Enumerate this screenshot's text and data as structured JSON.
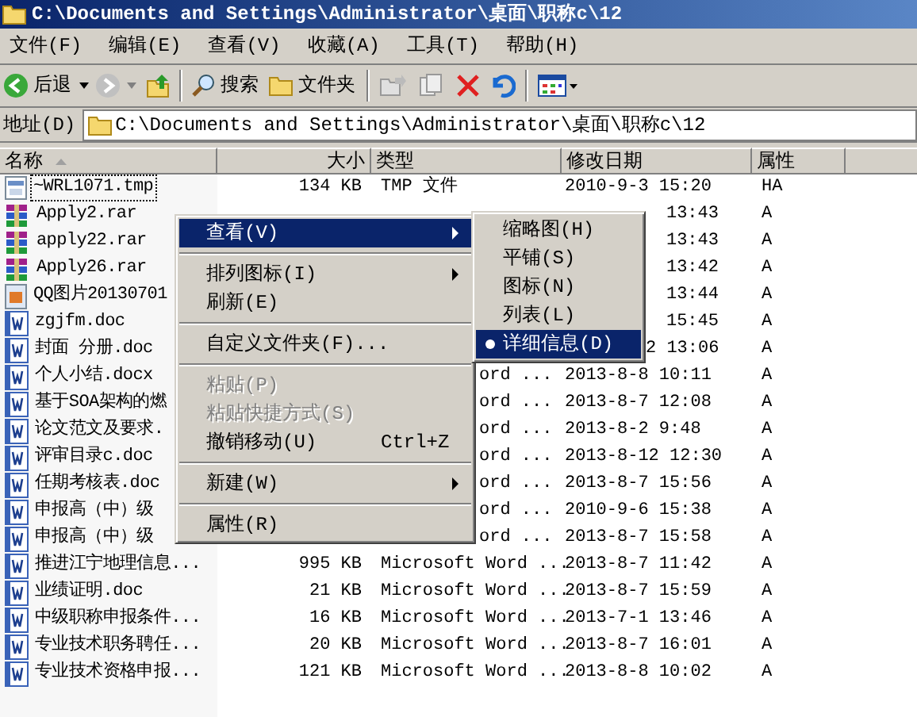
{
  "window": {
    "title": "C:\\Documents and Settings\\Administrator\\桌面\\职称c\\12"
  },
  "menu_bar": [
    "文件(F)",
    "编辑(E)",
    "查看(V)",
    "收藏(A)",
    "工具(T)",
    "帮助(H)"
  ],
  "toolbar": {
    "back": "后退",
    "search": "搜索",
    "folders": "文件夹"
  },
  "address": {
    "label": "地址(D)",
    "value": "C:\\Documents and Settings\\Administrator\\桌面\\职称c\\12"
  },
  "columns": [
    "名称",
    "大小",
    "类型",
    "修改日期",
    "属性"
  ],
  "rows": [
    {
      "kind": "tmp",
      "name": "~WRL1071.tmp",
      "size": "134 KB",
      "type": "TMP 文件",
      "date": "2010-9-3 15:20",
      "attr": "HA",
      "selected": true
    },
    {
      "kind": "rar",
      "name": "Apply2.rar",
      "date": "13:43",
      "attr": "A",
      "selected": false
    },
    {
      "kind": "rar",
      "name": "apply22.rar",
      "date": "13:43",
      "attr": "A",
      "selected": false
    },
    {
      "kind": "rar",
      "name": "Apply26.rar",
      "date": "13:42",
      "attr": "A",
      "selected": false
    },
    {
      "kind": "image",
      "name": "QQ图片20130701",
      "date": "13:44",
      "attr": "A",
      "selected": false
    },
    {
      "kind": "word",
      "name": "zgjfm.doc",
      "date": "15:45",
      "attr": "A",
      "selected": false
    },
    {
      "kind": "word",
      "name": "封面 分册.doc",
      "date": "2 13:06",
      "attr": "A",
      "selected": false
    },
    {
      "kind": "word",
      "name": "个人小结.docx",
      "type": "ord ...",
      "date": "2013-8-8 10:11",
      "attr": "A",
      "selected": false
    },
    {
      "kind": "word",
      "name": "基于SOA架构的燃",
      "type": "ord ...",
      "date": "2013-8-7 12:08",
      "attr": "A",
      "selected": false
    },
    {
      "kind": "word",
      "name": "论文范文及要求.",
      "type": "ord ...",
      "date": "2013-8-2 9:48",
      "attr": "A",
      "selected": false
    },
    {
      "kind": "word",
      "name": "评审目录c.doc",
      "type": "ord ...",
      "date": "2013-8-12 12:30",
      "attr": "A",
      "selected": false
    },
    {
      "kind": "word",
      "name": "任期考核表.doc",
      "type": "ord ...",
      "date": "2013-8-7 15:56",
      "attr": "A",
      "selected": false
    },
    {
      "kind": "word",
      "name": "申报高（中）级",
      "type": "ord ...",
      "date": "2010-9-6 15:38",
      "attr": "A",
      "selected": false
    },
    {
      "kind": "word",
      "name": "申报高（中）级",
      "type": "ord ...",
      "date": "2013-8-7 15:58",
      "attr": "A",
      "selected": false
    },
    {
      "kind": "word",
      "name": "推进江宁地理信息...",
      "size": "995 KB",
      "type": "Microsoft Word ...",
      "date": "2013-8-7 11:42",
      "attr": "A",
      "selected": false
    },
    {
      "kind": "word",
      "name": "业绩证明.doc",
      "size": "21 KB",
      "type": "Microsoft Word ...",
      "date": "2013-8-7 15:59",
      "attr": "A",
      "selected": false
    },
    {
      "kind": "word",
      "name": "中级职称申报条件...",
      "size": "16 KB",
      "type": "Microsoft Word ...",
      "date": "2013-7-1 13:46",
      "attr": "A",
      "selected": false
    },
    {
      "kind": "word",
      "name": "专业技术职务聘任...",
      "size": "20 KB",
      "type": "Microsoft Word ...",
      "date": "2013-8-7 16:01",
      "attr": "A",
      "selected": false
    },
    {
      "kind": "word",
      "name": "专业技术资格申报...",
      "size": "121 KB",
      "type": "Microsoft Word ...",
      "date": "2013-8-8 10:02",
      "attr": "A",
      "selected": false
    }
  ],
  "context_menu": [
    {
      "kind": "item",
      "label": "查看(V)",
      "submenu": true,
      "selected": true,
      "disabled": false
    },
    {
      "kind": "separator"
    },
    {
      "kind": "item",
      "label": "排列图标(I)",
      "submenu": true,
      "selected": false,
      "disabled": false
    },
    {
      "kind": "item",
      "label": "刷新(E)",
      "submenu": false,
      "selected": false,
      "disabled": false
    },
    {
      "kind": "separator"
    },
    {
      "kind": "item",
      "label": "自定义文件夹(F)...",
      "submenu": false,
      "selected": false,
      "disabled": false
    },
    {
      "kind": "separator"
    },
    {
      "kind": "item",
      "label": "粘贴(P)",
      "submenu": false,
      "selected": false,
      "disabled": true
    },
    {
      "kind": "item",
      "label": "粘贴快捷方式(S)",
      "submenu": false,
      "selected": false,
      "disabled": true
    },
    {
      "kind": "item",
      "label": "撤销移动(U)",
      "shortcut": "Ctrl+Z",
      "submenu": false,
      "selected": false,
      "disabled": false
    },
    {
      "kind": "separator"
    },
    {
      "kind": "item",
      "label": "新建(W)",
      "submenu": true,
      "selected": false,
      "disabled": false
    },
    {
      "kind": "separator"
    },
    {
      "kind": "item",
      "label": "属性(R)",
      "submenu": false,
      "selected": false,
      "disabled": false
    }
  ],
  "view_submenu": [
    {
      "label": "缩略图(H)",
      "checked": false,
      "selected": false
    },
    {
      "label": "平铺(S)",
      "checked": false,
      "selected": false
    },
    {
      "label": "图标(N)",
      "checked": false,
      "selected": false
    },
    {
      "label": "列表(L)",
      "checked": false,
      "selected": false
    },
    {
      "label": "详细信息(D)",
      "checked": true,
      "selected": true
    }
  ]
}
